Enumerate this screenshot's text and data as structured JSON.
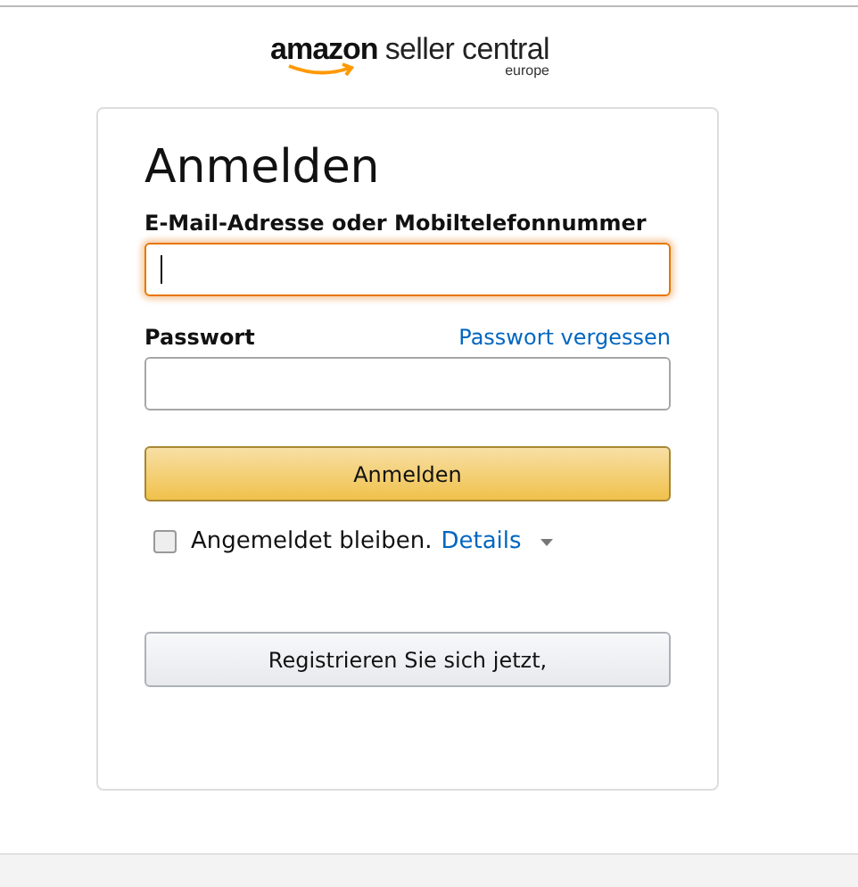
{
  "logo": {
    "brand": "amazon",
    "product": "seller central",
    "region": "europe"
  },
  "form": {
    "title": "Anmelden",
    "email": {
      "label": "E-Mail-Adresse oder Mobiltelefonnummer",
      "focused": true
    },
    "password": {
      "label": "Passwort",
      "forgot_link": "Passwort vergessen",
      "focused": false
    },
    "submit": "Anmelden",
    "remember": {
      "label": "Angemeldet bleiben.",
      "details_link": "Details",
      "checked": false
    },
    "register": "Registrieren Sie sich jetzt,"
  }
}
